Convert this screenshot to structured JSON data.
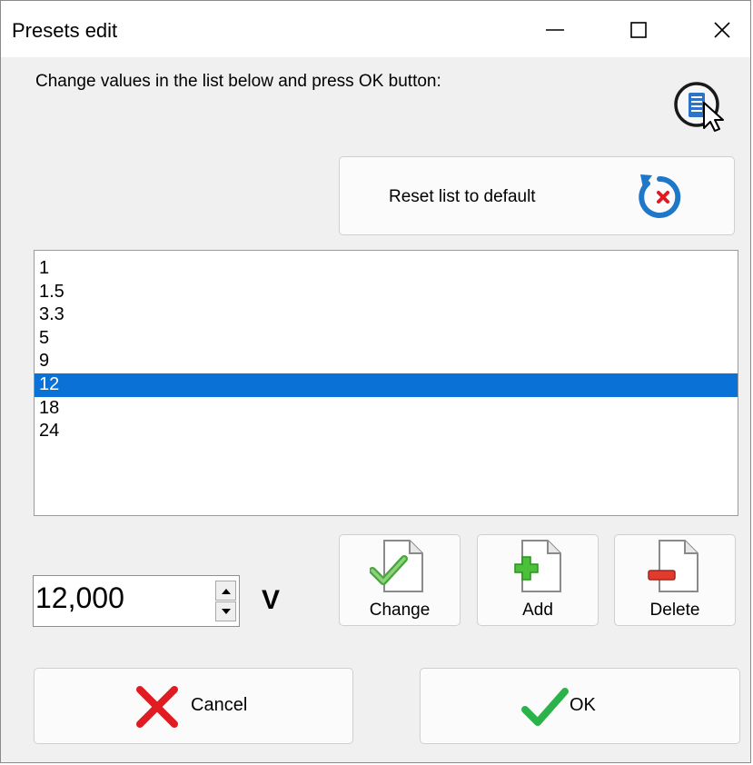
{
  "window": {
    "title": "Presets edit"
  },
  "dialog": {
    "prompt": "Change values in the list below and press OK button:",
    "reset_label": "Reset list to default",
    "presets": [
      "1",
      "1.5",
      "3.3",
      "5",
      "9",
      "12",
      "18",
      "24"
    ],
    "selected_value": "12",
    "value_input": "12,000",
    "unit": "V",
    "change_label": "Change",
    "add_label": "Add",
    "delete_label": "Delete",
    "cancel_label": "Cancel",
    "ok_label": "OK"
  },
  "colors": {
    "selection": "#0a72d6",
    "accent_blue": "#1f77c9",
    "red": "#e11b22",
    "green": "#2bb34a"
  },
  "icons": [
    "minimize-icon",
    "maximize-icon",
    "close-icon",
    "help-cursor-icon",
    "reset-icon",
    "change-document-icon",
    "add-document-icon",
    "delete-document-icon",
    "cancel-x-icon",
    "ok-check-icon",
    "spin-up-icon",
    "spin-down-icon"
  ]
}
